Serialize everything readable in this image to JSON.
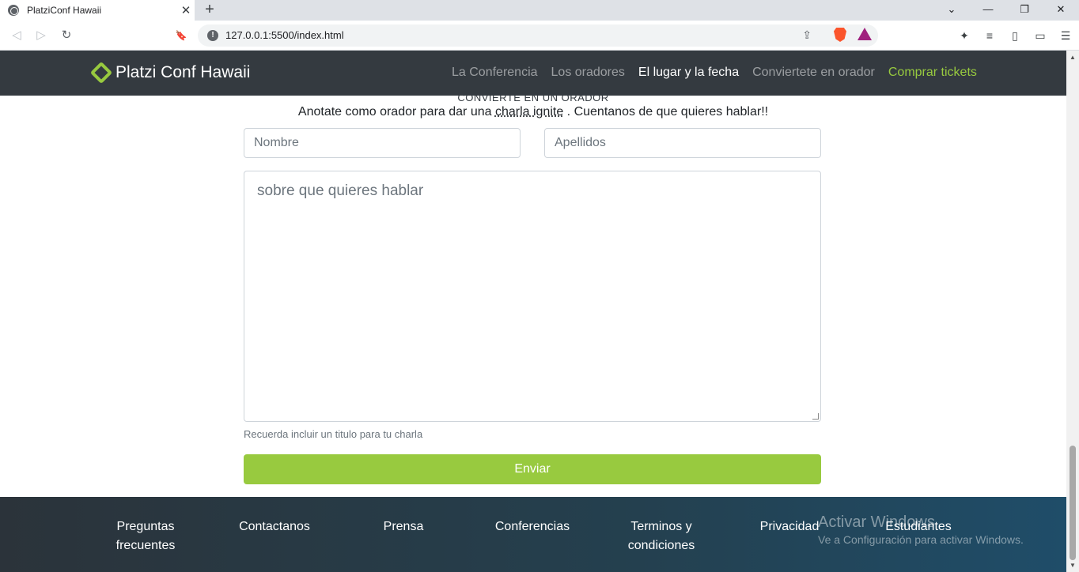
{
  "browser": {
    "tab_title": "PlatziConf Hawaii",
    "tab_close": "✕",
    "new_tab": "+",
    "url": "127.0.0.1:5500/index.html",
    "window_controls": {
      "dropdown": "⌄",
      "minimize": "—",
      "restore": "❐",
      "close": "✕"
    },
    "nav": {
      "back": "◁",
      "forward": "▷",
      "reload": "↻",
      "bookmark": "🔖"
    },
    "omnibox_icons": {
      "info": "!",
      "share": "⇪"
    },
    "extension_icons": [
      "puzzle-icon",
      "playlist-icon",
      "sidebar-icon",
      "wallet-icon",
      "menu-icon"
    ],
    "extension_glyphs": [
      "✦",
      "≡",
      "▯",
      "▭",
      "☰"
    ]
  },
  "site": {
    "brand": "Platzi Conf Hawaii",
    "nav": {
      "la_conferencia": "La Conferencia",
      "los_oradores": "Los oradores",
      "el_lugar": "El lugar y la fecha",
      "conviertete": "Conviertete en orador",
      "comprar": "Comprar tickets"
    },
    "form": {
      "section_heading": "CONVIERTE EN UN ORADOR",
      "intro_before": "Anotate como orador para dar una ",
      "intro_highlight": "charla ignite",
      "intro_after": " . Cuentanos de que quieres hablar!!",
      "nombre_placeholder": "Nombre",
      "apellidos_placeholder": "Apellidos",
      "topic_placeholder": "sobre que quieres hablar",
      "help": "Recuerda incluir un titulo para tu charla",
      "submit": "Enviar"
    },
    "footer": {
      "preguntas_1": "Preguntas",
      "preguntas_2": "frecuentes",
      "contactanos": "Contactanos",
      "prensa": "Prensa",
      "conferencias": "Conferencias",
      "terminos_1": "Terminos y",
      "terminos_2": "condiciones",
      "privacidad": "Privacidad",
      "estudiantes": "Estudiantes"
    }
  },
  "overlay": {
    "title": "Activar Windows",
    "subtitle": "Ve a Configuración para activar Windows."
  },
  "colors": {
    "accent": "#98ca3f",
    "navbar": "#343a40",
    "footer_start": "#2b333a",
    "footer_end": "#1f4d69"
  }
}
